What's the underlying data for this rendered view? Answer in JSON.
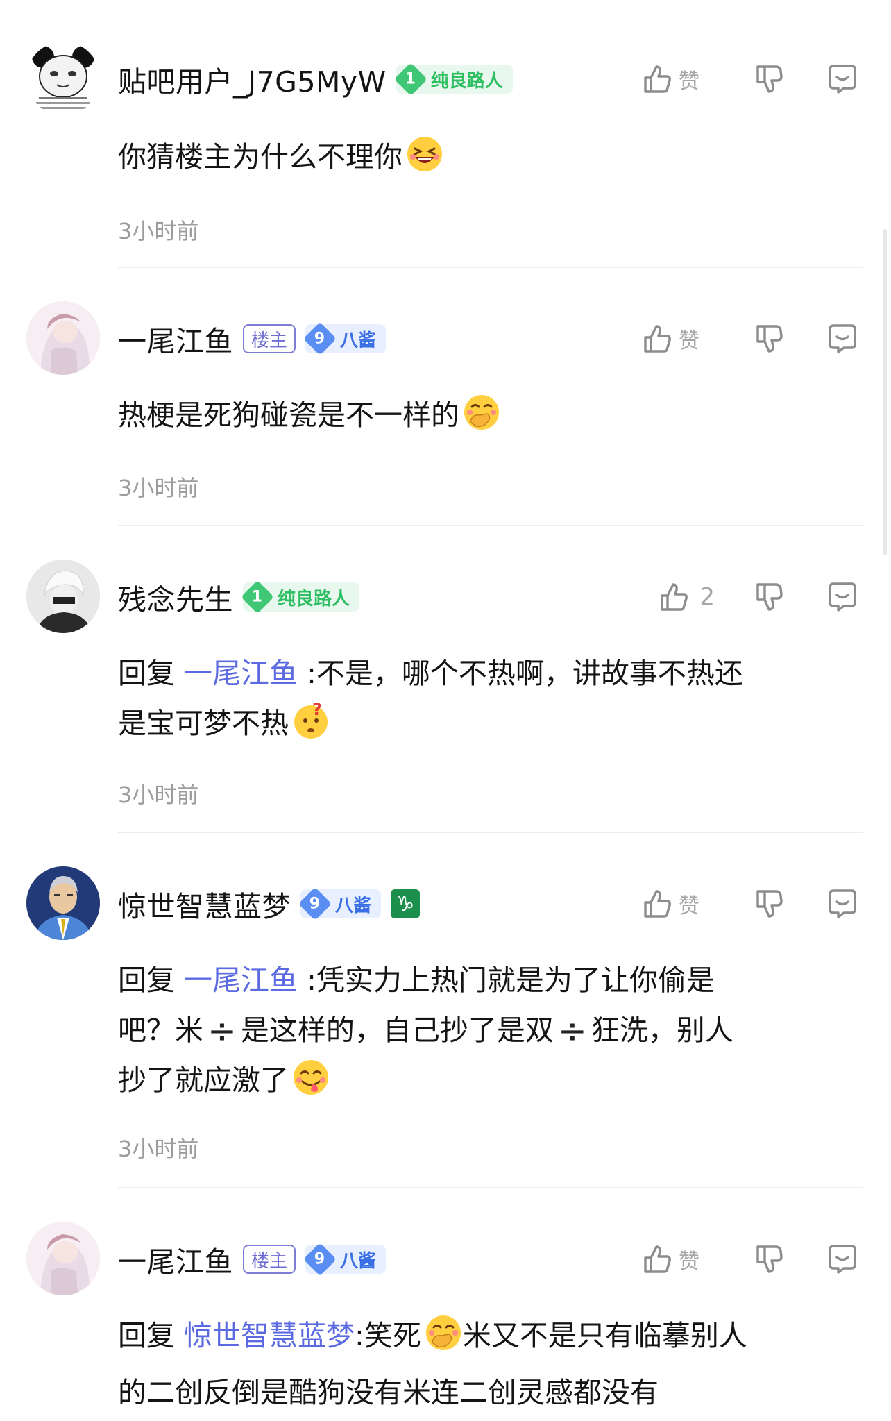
{
  "like_label": "赞",
  "comments": [
    {
      "username": "贴吧用户_J7G5MyW",
      "level": "1",
      "level_title": "纯良路人",
      "is_op": false,
      "op_label": "",
      "zodiac": "",
      "likes": "",
      "reply_prefix": "",
      "mention": "",
      "text": "你猜楼主为什么不理你",
      "text2": "",
      "text3": "",
      "emoji": "grinning-squint-emoji",
      "time": "3小时前"
    },
    {
      "username": "一尾江鱼",
      "level": "9",
      "level_title": "八酱",
      "is_op": true,
      "op_label": "楼主",
      "zodiac": "",
      "likes": "",
      "text": "热梗是死狗碰瓷是不一样的",
      "emoji": "hand-over-mouth-emoji",
      "time": "3小时前"
    },
    {
      "username": "残念先生",
      "level": "1",
      "level_title": "纯良路人",
      "likes": "2",
      "reply_prefix": "回复",
      "mention": "一尾江鱼",
      "text": ":不是，哪个不热啊，讲故事不热还",
      "text2": "是宝可梦不热",
      "emoji": "thinking-question-emoji",
      "time": "3小时前"
    },
    {
      "username": "惊世智慧蓝梦",
      "level": "9",
      "level_title": "八酱",
      "zodiac": "♑",
      "reply_prefix": "回复",
      "mention": "一尾江鱼",
      "text": ":凭实力上热门就是为了让你偷是",
      "text2a": "吧？米",
      "text2b": "是这样的，自己抄了是双",
      "text2c": "狂洗，别人",
      "divide_symbol": "÷",
      "text3": "抄了就应激了",
      "emoji": "yum-tongue-emoji",
      "time": "3小时前"
    },
    {
      "username": "一尾江鱼",
      "level": "9",
      "level_title": "八酱",
      "op_label": "楼主",
      "reply_prefix": "回复",
      "mention": "惊世智慧蓝梦",
      "text_a": ":笑死",
      "text_b": "米又不是只有临摹别人",
      "text2": "的二创反倒是酷狗没有米连二创灵感都没有",
      "emoji": "hand-over-mouth-emoji"
    }
  ]
}
